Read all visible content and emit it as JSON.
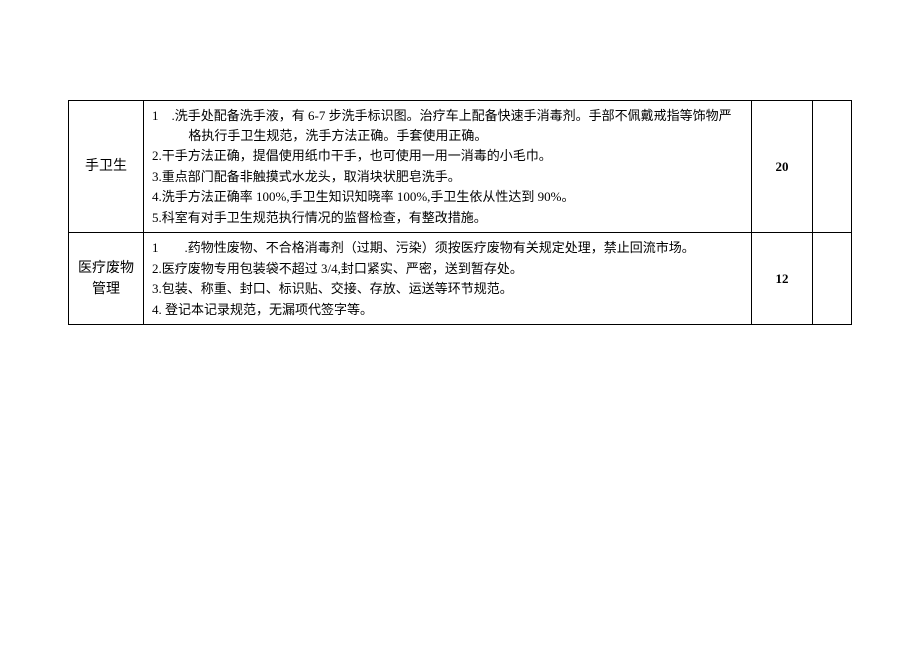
{
  "rows": [
    {
      "category": "手卫生",
      "score": "20",
      "items": [
        "1　.洗手处配备洗手液，有 6-7 步洗手标识图。治疗车上配备快速手消毒剂。手部不佩戴戒指等饰物严格执行手卫生规范，洗手方法正确。手套使用正确。",
        "2.干手方法正确，提倡使用纸巾干手，也可使用一用一消毒的小毛巾。",
        "3.重点部门配备非触摸式水龙头，取消块状肥皂洗手。",
        "4.洗手方法正确率 100%,手卫生知识知晓率 100%,手卫生依从性达到 90%。",
        "5.科室有对手卫生规范执行情况的监督检查，有整改措施。"
      ]
    },
    {
      "category": "医疗废物管理",
      "score": "12",
      "items": [
        "1　　.药物性废物、不合格消毒剂（过期、污染）须按医疗废物有关规定处理，禁止回流市场。",
        "2.医疗废物专用包装袋不超过 3/4,封口紧实、严密，送到暂存处。",
        "3.包装、称重、封口、标识贴、交接、存放、运送等环节规范。",
        "4. 登记本记录规范，无漏项代签字等。"
      ]
    }
  ]
}
